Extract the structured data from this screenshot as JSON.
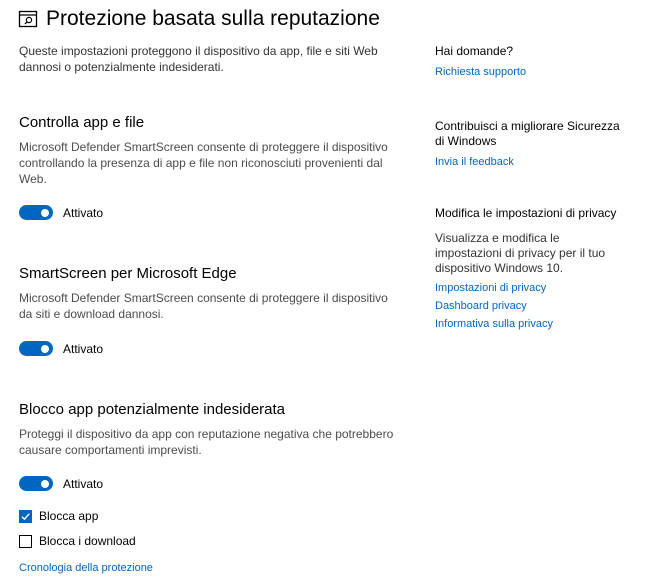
{
  "header": {
    "title": "Protezione basata sulla reputazione",
    "icon": "browser-shield-icon"
  },
  "intro": "Queste impostazioni proteggono il dispositivo da app, file e siti Web dannosi o potenzialmente indesiderati.",
  "sections": {
    "apps_files": {
      "title": "Controlla app e file",
      "description": "Microsoft Defender SmartScreen consente di proteggere il dispositivo controllando la presenza di app e file non riconosciuti provenienti dal Web.",
      "toggle_label": "Attivato",
      "toggle_on": true
    },
    "edge": {
      "title": "SmartScreen per Microsoft Edge",
      "description": "Microsoft Defender SmartScreen consente di proteggere il dispositivo da siti e download dannosi.",
      "toggle_label": "Attivato",
      "toggle_on": true
    },
    "pua": {
      "title": "Blocco app potenzialmente indesiderata",
      "description": "Proteggi il dispositivo da app con reputazione negativa che potrebbero causare comportamenti imprevisti.",
      "toggle_label": "Attivato",
      "toggle_on": true,
      "block_apps": {
        "label": "Blocca app",
        "checked": true
      },
      "block_downloads": {
        "label": "Blocca i download",
        "checked": false
      }
    }
  },
  "history_link": "Cronologia della protezione",
  "sidebar": {
    "questions": {
      "heading": "Hai domande?",
      "link": "Richiesta supporto"
    },
    "feedback": {
      "heading": "Contribuisci a migliorare Sicurezza di Windows",
      "link": "Invia il feedback"
    },
    "privacy": {
      "heading": "Modifica le impostazioni di privacy",
      "text": "Visualizza e modifica le impostazioni di privacy per il tuo dispositivo Windows 10.",
      "links": [
        "Impostazioni di privacy",
        "Dashboard privacy",
        "Informativa sulla privacy"
      ]
    }
  },
  "colors": {
    "accent": "#0067c0",
    "text": "#000000",
    "secondary_text": "#4c4c4c"
  }
}
